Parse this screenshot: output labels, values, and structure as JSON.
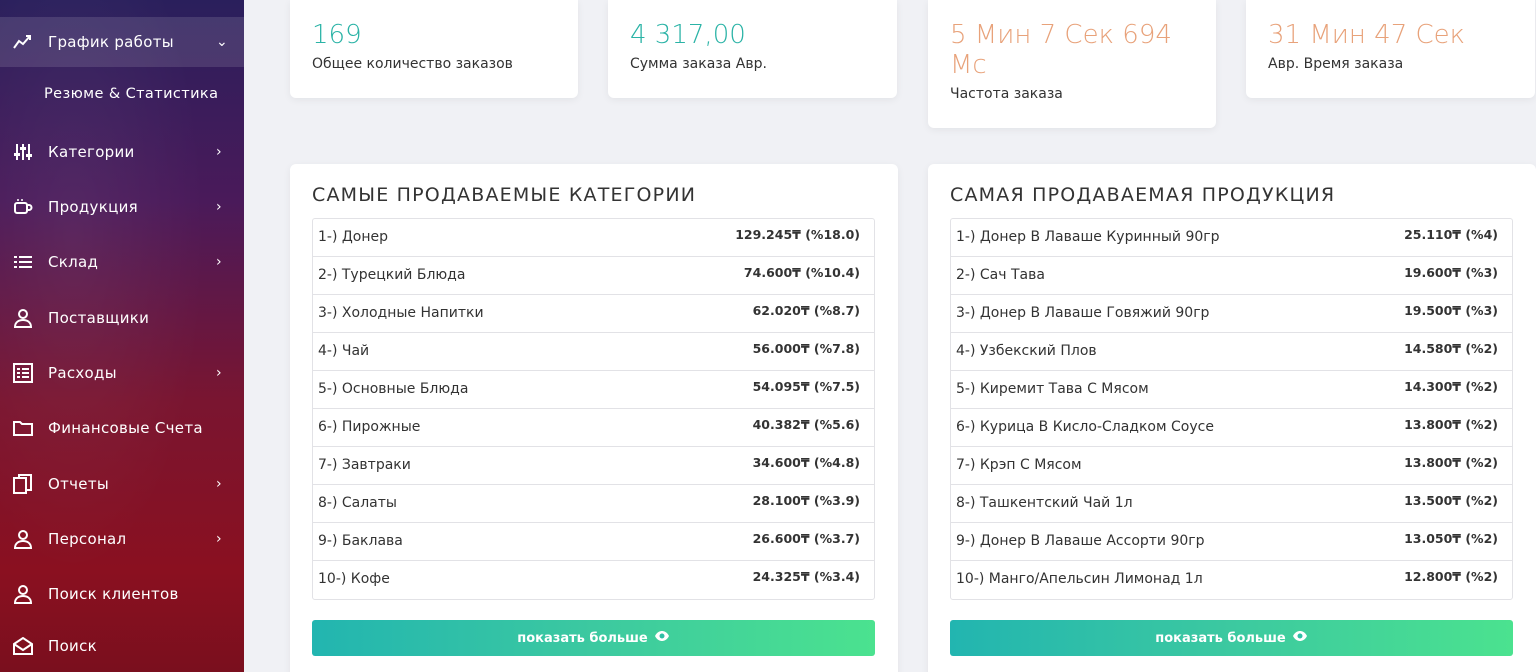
{
  "sidebar": {
    "items": [
      {
        "label": "График работы",
        "icon": "chart-line-icon"
      },
      {
        "label": "Категории",
        "icon": "sliders-icon"
      },
      {
        "label": "Продукция",
        "icon": "coffee-cup-icon"
      },
      {
        "label": "Склад",
        "icon": "list-icon"
      },
      {
        "label": "Поставщики",
        "icon": "user-icon"
      },
      {
        "label": "Расходы",
        "icon": "checklist-icon"
      },
      {
        "label": "Финансовые Счета",
        "icon": "folder-icon"
      },
      {
        "label": "Отчеты",
        "icon": "documents-icon"
      },
      {
        "label": "Персонал",
        "icon": "user-icon"
      },
      {
        "label": "Поиск клиентов",
        "icon": "user-icon"
      },
      {
        "label": "Поиск",
        "icon": "envelope-icon"
      }
    ],
    "sub_item": "Резюме & Статистика"
  },
  "stats": [
    {
      "value": "169",
      "label": "Общее количество заказов"
    },
    {
      "value": "4 317,00",
      "label": "Сумма заказа Авр."
    },
    {
      "value": "5 Мин 7 Сек 694 Мс",
      "label": "Частота заказа"
    },
    {
      "value": "31 Мин 47 Сек",
      "label": "Авр. Время заказа"
    }
  ],
  "categories": {
    "title": "САМЫЕ ПРОДАВАЕМЫЕ КАТЕГОРИИ",
    "rows": [
      {
        "name": "1-) Донер",
        "amount": "129.245₸ (%18.0)"
      },
      {
        "name": "2-) Турецкий Блюда",
        "amount": "74.600₸ (%10.4)"
      },
      {
        "name": "3-) Холодные Напитки",
        "amount": "62.020₸ (%8.7)"
      },
      {
        "name": "4-) Чай",
        "amount": "56.000₸ (%7.8)"
      },
      {
        "name": "5-) Основные Блюда",
        "amount": "54.095₸ (%7.5)"
      },
      {
        "name": "6-) Пирожные",
        "amount": "40.382₸ (%5.6)"
      },
      {
        "name": "7-) Завтраки",
        "amount": "34.600₸ (%4.8)"
      },
      {
        "name": "8-) Салаты",
        "amount": "28.100₸ (%3.9)"
      },
      {
        "name": "9-) Баклава",
        "amount": "26.600₸ (%3.7)"
      },
      {
        "name": "10-) Кофе",
        "amount": "24.325₸ (%3.4)"
      }
    ],
    "button": "показать больше"
  },
  "products": {
    "title": "САМАЯ ПРОДАВАЕМАЯ ПРОДУКЦИЯ",
    "rows": [
      {
        "name": "1-) Донер В Лаваше Куринный 90гр",
        "amount": "25.110₸ (%4)"
      },
      {
        "name": "2-) Сач Тава",
        "amount": "19.600₸ (%3)"
      },
      {
        "name": "3-) Донер В Лаваше Говяжий 90гр",
        "amount": "19.500₸ (%3)"
      },
      {
        "name": "4-) Узбекский Плов",
        "amount": "14.580₸ (%2)"
      },
      {
        "name": "5-) Киремит Тава С Мясом",
        "amount": "14.300₸ (%2)"
      },
      {
        "name": "6-) Курица В Кисло-Сладком Соусе",
        "amount": "13.800₸ (%2)"
      },
      {
        "name": "7-) Крэп С Мясом",
        "amount": "13.800₸ (%2)"
      },
      {
        "name": "8-) Ташкентский Чай 1л",
        "amount": "13.500₸ (%2)"
      },
      {
        "name": "9-) Донер В Лаваше Ассорти 90гр",
        "amount": "13.050₸ (%2)"
      },
      {
        "name": "10-) Манго/Апельсин Лимонад 1л",
        "amount": "12.800₸ (%2)"
      }
    ],
    "button": "показать больше"
  },
  "colors": {
    "teal": "#2ab3a6",
    "orange": "#e8a27a",
    "button_gradient_start": "#22b5b0",
    "button_gradient_end": "#4be28f"
  }
}
